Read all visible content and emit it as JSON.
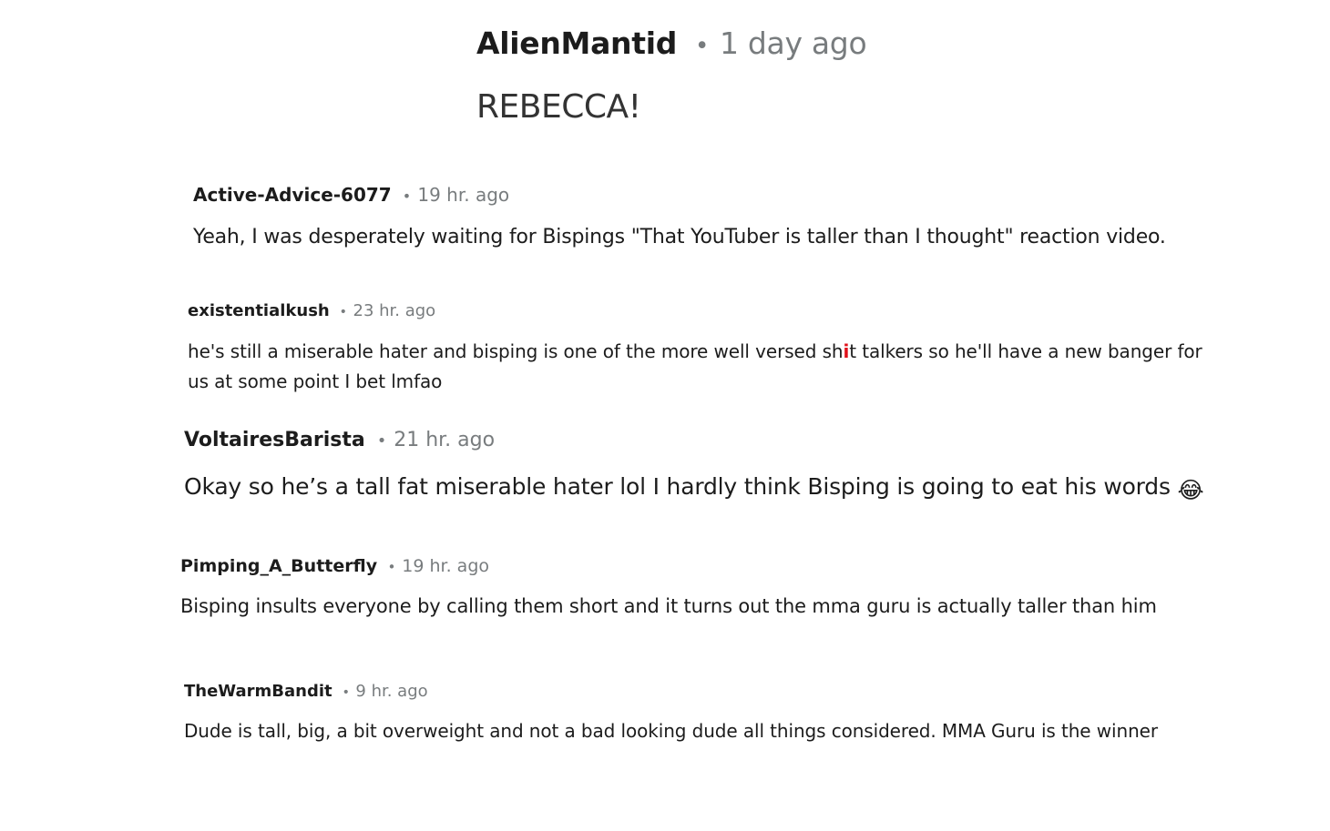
{
  "comments": [
    {
      "author": "AlienMantid",
      "separator": "•",
      "time": "1 day ago",
      "text": "REBECCA!"
    },
    {
      "author": "Active-Advice-6077",
      "separator": "•",
      "time": "19 hr. ago",
      "text": "Yeah, I was desperately waiting for Bispings \"That YouTuber is taller than I thought\" reaction video."
    },
    {
      "author": "existentialkush",
      "separator": "•",
      "time": "23 hr. ago",
      "text_before": "he's still a miserable hater and bisping is one of the more well versed sh",
      "censor_mark": "i",
      "text_after": "t talkers so he'll have a new banger for us at some point I bet lmfao"
    },
    {
      "author": "VoltairesBarista",
      "separator": "•",
      "time": "21 hr. ago",
      "text": "Okay so he’s a tall fat miserable hater lol I hardly think Bisping is going to eat his words",
      "emoji": "😂",
      "emoji_icon": "laughing-tears-emoji-icon"
    },
    {
      "author": "Pimping_A_Butterfly",
      "separator": "•",
      "time": "19 hr. ago",
      "text": "Bisping insults everyone by calling them short and it turns out the mma guru is actually taller than him"
    },
    {
      "author": "TheWarmBandit",
      "separator": "•",
      "time": "9 hr. ago",
      "text": "Dude is tall, big, a bit overweight and not a bad looking dude all things considered. MMA Guru is the winner"
    }
  ],
  "colors": {
    "author": "#1c1c1c",
    "meta": "#787c7e",
    "censor": "#e0121b",
    "background": "#ffffff"
  }
}
